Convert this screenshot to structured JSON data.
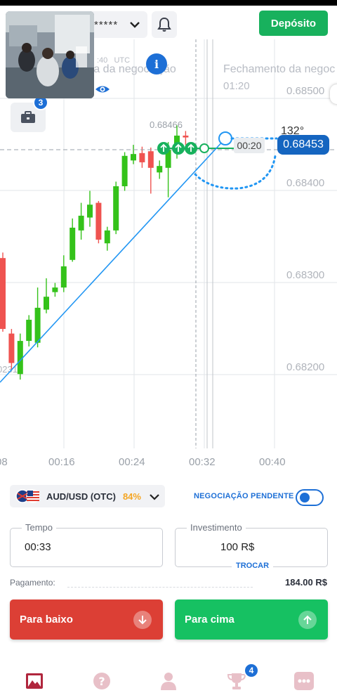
{
  "header": {
    "account_masked": "*****",
    "deposit_label": "Depósito"
  },
  "chart": {
    "info_label": "i",
    "open_label": "ra da negociação",
    "open_time": ":40",
    "open_tz": "UTC",
    "close_label": "Fechamento da negoc",
    "close_time": "01:20",
    "current_price": "0.68453",
    "timer": "00:20",
    "angle": "132°",
    "briefcase_badge": "3",
    "marker_price": "0.68466",
    "left_partial_price": "0231"
  },
  "chart_data": {
    "type": "candlestick",
    "y_ticks": [
      "0.68500",
      "0.68400",
      "0.68300",
      "0.68200"
    ],
    "x_ticks": [
      "08",
      "00:16",
      "00:24",
      "00:32",
      "00:40"
    ],
    "ylim": [
      0.6815,
      0.6853
    ],
    "candles": [
      {
        "o": 0.68322,
        "c": 0.68245,
        "h": 0.68328,
        "l": 0.68242
      },
      {
        "o": 0.6824,
        "c": 0.68208,
        "h": 0.68245,
        "l": 0.682
      },
      {
        "o": 0.68196,
        "c": 0.68232,
        "h": 0.6824,
        "l": 0.6819
      },
      {
        "o": 0.68232,
        "c": 0.68255,
        "h": 0.6826,
        "l": 0.68226
      },
      {
        "o": 0.6823,
        "c": 0.68268,
        "h": 0.6829,
        "l": 0.68225
      },
      {
        "o": 0.68266,
        "c": 0.6828,
        "h": 0.683,
        "l": 0.68262
      },
      {
        "o": 0.68285,
        "c": 0.6829,
        "h": 0.68295,
        "l": 0.6828
      },
      {
        "o": 0.6829,
        "c": 0.68313,
        "h": 0.68325,
        "l": 0.68285
      },
      {
        "o": 0.6832,
        "c": 0.68355,
        "h": 0.68365,
        "l": 0.68318
      },
      {
        "o": 0.68352,
        "c": 0.68368,
        "h": 0.68382,
        "l": 0.68342
      },
      {
        "o": 0.68366,
        "c": 0.6838,
        "h": 0.68395,
        "l": 0.68356
      },
      {
        "o": 0.68382,
        "c": 0.68342,
        "h": 0.68384,
        "l": 0.68338
      },
      {
        "o": 0.68338,
        "c": 0.68352,
        "h": 0.68356,
        "l": 0.6833
      },
      {
        "o": 0.68352,
        "c": 0.684,
        "h": 0.68405,
        "l": 0.68348
      },
      {
        "o": 0.684,
        "c": 0.68433,
        "h": 0.68437,
        "l": 0.68395
      },
      {
        "o": 0.68428,
        "c": 0.68435,
        "h": 0.68445,
        "l": 0.68424
      },
      {
        "o": 0.68436,
        "c": 0.68426,
        "h": 0.68443,
        "l": 0.6842
      },
      {
        "o": 0.68438,
        "c": 0.6842,
        "h": 0.68442,
        "l": 0.68392
      },
      {
        "o": 0.68415,
        "c": 0.68422,
        "h": 0.68428,
        "l": 0.68408
      },
      {
        "o": 0.6842,
        "c": 0.6844,
        "h": 0.68448,
        "l": 0.68388
      },
      {
        "o": 0.6844,
        "c": 0.68455,
        "h": 0.68466,
        "l": 0.6843
      },
      {
        "o": 0.68455,
        "c": 0.68453,
        "h": 0.6846,
        "l": 0.68445
      }
    ],
    "grid": true
  },
  "asset": {
    "name": "AUD/USD (OTC)",
    "payout": "84%",
    "pending_label": "NEGOCIAÇÃO PENDENTE"
  },
  "form": {
    "time_label": "Tempo",
    "time_value": "00:33",
    "invest_label": "Investimento",
    "invest_value": "100 R$",
    "switch_label": "TROCAR",
    "payout_label": "Pagamento:",
    "payout_value": "184.00 R$"
  },
  "actions": {
    "down_label": "Para baixo",
    "up_label": "Para cima"
  },
  "nav": {
    "trophy_badge": "4"
  },
  "colors": {
    "green": "#18b15d",
    "red": "#dc3f35",
    "blue": "#1d6fd6",
    "candle_up": "#34c21a",
    "candle_down": "#ef5350"
  }
}
